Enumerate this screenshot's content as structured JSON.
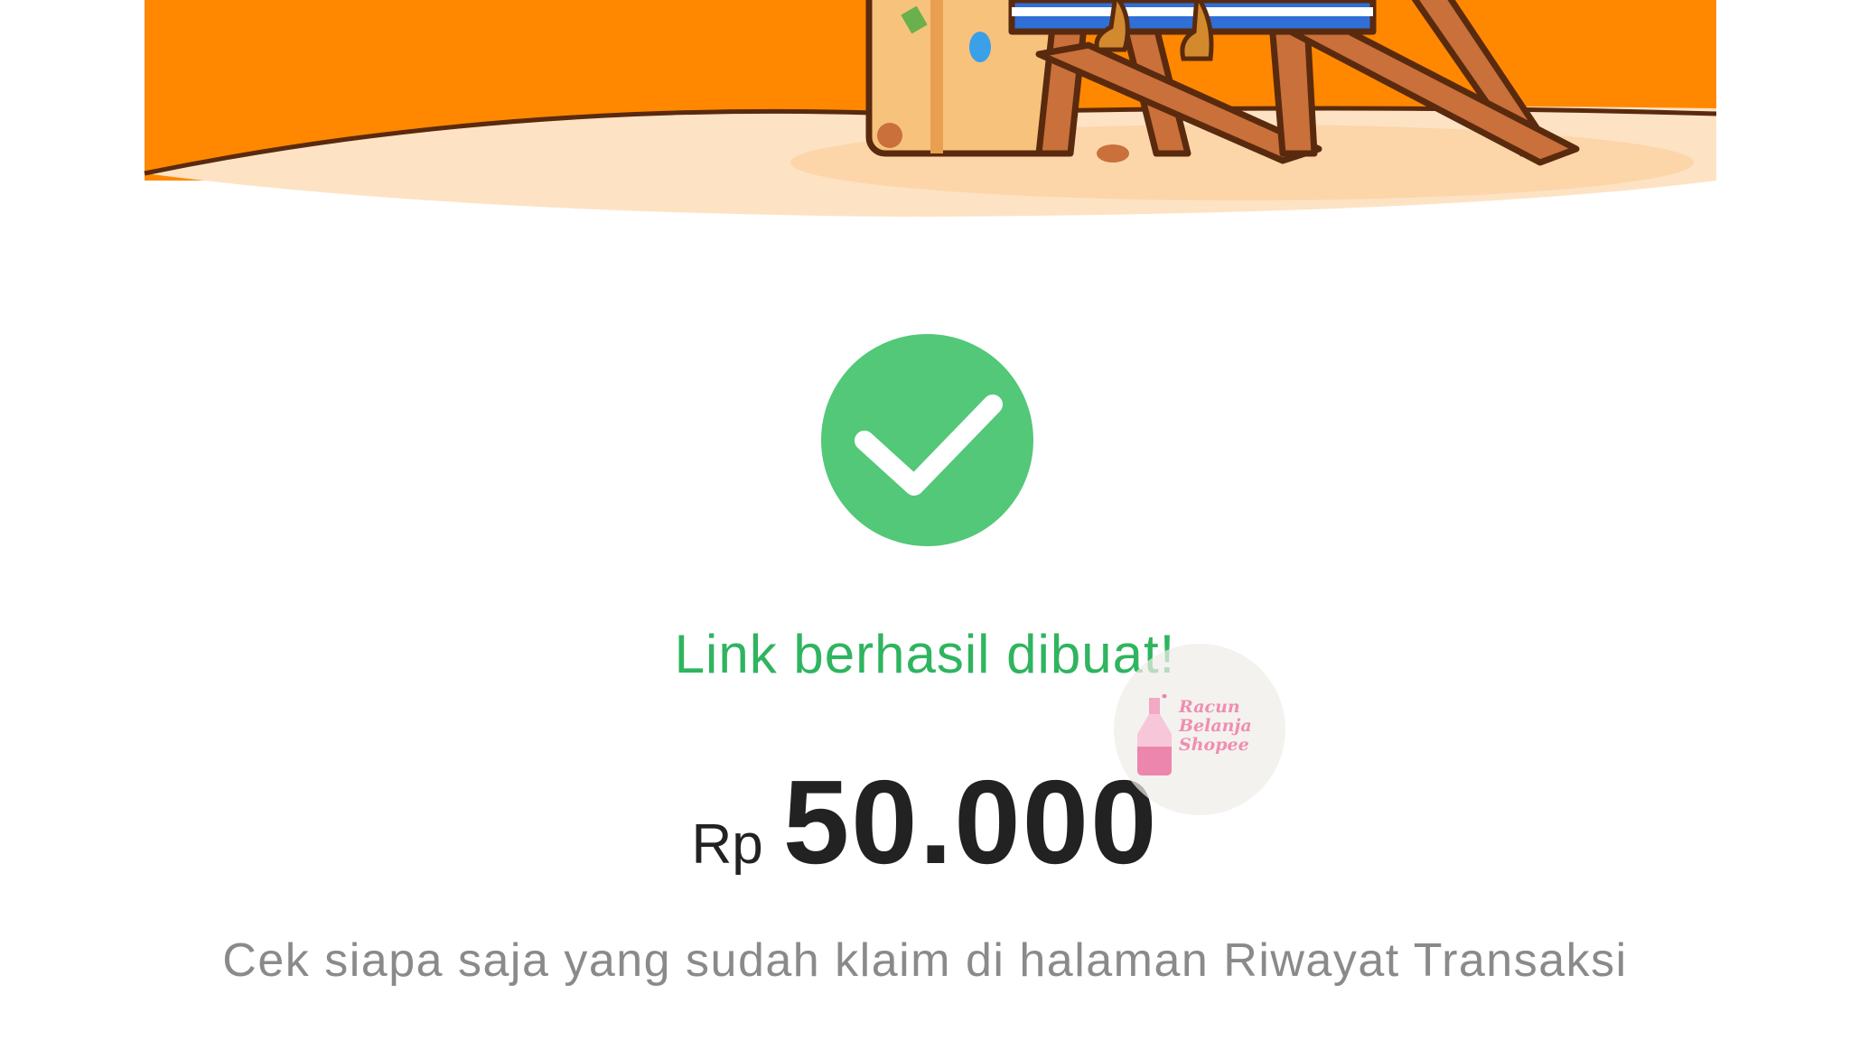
{
  "header": {
    "illustration_icon": "beach-chair-illustration"
  },
  "status": {
    "icon": "check-circle-icon",
    "title": "Link berhasil dibuat!",
    "color": "#2fb45f"
  },
  "amount": {
    "currency": "Rp",
    "value": "50.000"
  },
  "info": {
    "text": "Cek siapa saja yang sudah klaim di halaman Riwayat Transaksi"
  },
  "watermark": {
    "lines": [
      "Racun",
      "Belanja",
      "Shopee"
    ],
    "color": "#ef8eb2"
  },
  "colors": {
    "brand_orange": "#ff8800",
    "sand": "#fde3c4"
  }
}
